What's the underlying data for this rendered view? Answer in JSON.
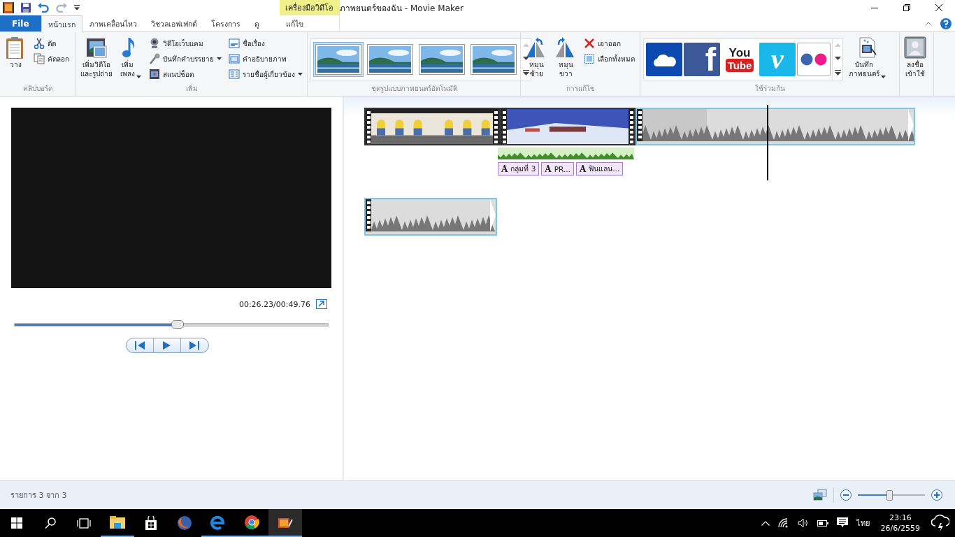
{
  "title_bar": {
    "title": "ภาพยนตร์ของฉัน - Movie Maker",
    "context_group": "เครื่องมือวิดีโอ"
  },
  "tabs": [
    {
      "label": "File",
      "kind": "file",
      "selected": false
    },
    {
      "label": "หน้าแรก",
      "kind": "normal",
      "selected": true
    },
    {
      "label": "ภาพเคลื่อนไหว",
      "kind": "normal",
      "selected": false
    },
    {
      "label": "วิชวลเอฟเฟกต์",
      "kind": "normal",
      "selected": false
    },
    {
      "label": "โครงการ",
      "kind": "normal",
      "selected": false
    },
    {
      "label": "ดู",
      "kind": "normal",
      "selected": false
    },
    {
      "label": "แก้ไข",
      "kind": "context",
      "selected": false
    }
  ],
  "ribbon": [
    {
      "label": "คลิปบอร์ด",
      "items": [
        {
          "kind": "large",
          "label": "วาง"
        },
        {
          "kind": "column",
          "items": [
            {
              "label": "ตัด"
            },
            {
              "label": "คัดลอก"
            }
          ]
        }
      ]
    },
    {
      "label": "เพิ่ม",
      "items": [
        {
          "kind": "large",
          "label": "เพิ่มวิดีโอ\nและรูปถ่าย"
        },
        {
          "kind": "large",
          "label": "เพิ่ม\nเพลง",
          "dropdown": true
        },
        {
          "kind": "column",
          "items": [
            {
              "label": "วิดีโอเว็บแคม"
            },
            {
              "label": "บันทึกคำบรรยาย",
              "dropdown": true
            },
            {
              "label": "สแนปช็อต"
            }
          ]
        },
        {
          "kind": "column",
          "items": [
            {
              "label": "ชื่อเรื่อง"
            },
            {
              "label": "คำอธิบายภาพ"
            },
            {
              "label": "รายชื่อผู้เกี่ยวข้อง",
              "dropdown": true
            }
          ]
        }
      ]
    },
    {
      "label": "ชุดรูปแบบภาพยนตร์อัตโนมัติ",
      "items": [
        {
          "kind": "themes",
          "items": [
            {
              "selected": true
            },
            {
              "selected": false
            },
            {
              "selected": false
            },
            {
              "selected": false
            }
          ]
        }
      ]
    },
    {
      "label": "การแก้ไข",
      "items": [
        {
          "kind": "large",
          "label": "หมุน\nซ้าย"
        },
        {
          "kind": "large",
          "label": "หมุน\nขวา"
        },
        {
          "kind": "column",
          "items": [
            {
              "label": "เอาออก"
            },
            {
              "label": "เลือกทั้งหมด"
            }
          ]
        }
      ]
    },
    {
      "label": "ใช้ร่วมกัน",
      "items": [
        {
          "kind": "share",
          "items": [
            {
              "kind": "onedrive"
            },
            {
              "kind": "facebook",
              "text": "f"
            },
            {
              "kind": "youtube",
              "text": "You",
              "text_2": "Tube"
            },
            {
              "kind": "vimeo",
              "text": "v"
            },
            {
              "kind": "flickr"
            }
          ]
        },
        {
          "kind": "large",
          "label": "บันทึก\nภาพยนตร์",
          "dropdown": true
        }
      ]
    },
    {
      "items": [
        {
          "kind": "large",
          "label": "ลงชื่อ\nเข้าใช้"
        }
      ]
    }
  ],
  "preview": {
    "time": "00:26.23/00:49.76",
    "seek": {
      "level": 0.52
    }
  },
  "timeline": {
    "tracks": [
      {
        "clips": [
          {
            "kind": "video",
            "selected": false
          },
          {
            "kind": "video",
            "selected": false
          },
          {
            "kind": "blank",
            "selected": true
          }
        ],
        "music": true,
        "captions": [
          {
            "mark": "A",
            "text": "กลุ่มที่ 3"
          },
          {
            "mark": "A",
            "text": "PR..."
          },
          {
            "mark": "A",
            "text": "ฟินแลน..."
          }
        ]
      },
      {
        "clips": [
          {
            "kind": "blank",
            "selected": true
          }
        ]
      }
    ]
  },
  "status_bar": {
    "text": "รายการ 3 จาก 3",
    "zoom": {
      "level": 0.48
    }
  },
  "taskbar": {
    "language": "ไทย",
    "time": "23:16",
    "date": "26/6/2559"
  }
}
